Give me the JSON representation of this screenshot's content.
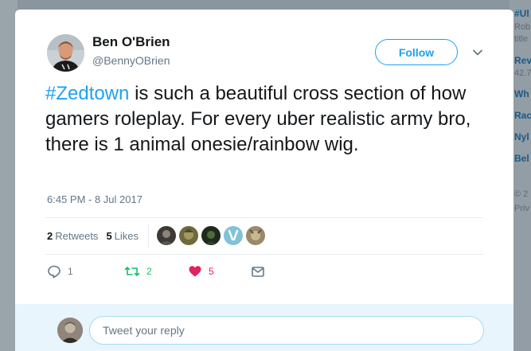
{
  "background": {
    "right_column": [
      {
        "text": "#Ul",
        "kind": "link"
      },
      {
        "text": "Rob",
        "kind": "text"
      },
      {
        "text": "title",
        "kind": "text"
      },
      {
        "text": "Rev",
        "kind": "link"
      },
      {
        "text": "42.7",
        "kind": "text"
      },
      {
        "text": "Wh",
        "kind": "link"
      },
      {
        "text": "Rac",
        "kind": "link"
      },
      {
        "text": "Nyl",
        "kind": "link"
      },
      {
        "text": "Bel",
        "kind": "link"
      },
      {
        "text": "© 2",
        "kind": "text"
      },
      {
        "text": "Priv",
        "kind": "text"
      }
    ]
  },
  "author": {
    "name": "Ben O'Brien",
    "handle": "@BennyOBrien",
    "avatar_icon": "user-avatar-photo"
  },
  "follow_label": "Follow",
  "tweet": {
    "hashtag": "#Zedtown",
    "text": " is such a beautiful cross section of how gamers roleplay. For every uber realistic army bro, there is 1 animal onesie/rainbow wig.",
    "timestamp": "6:45 PM - 8 Jul 2017"
  },
  "stats": {
    "retweets_count": "2",
    "retweets_label": "Retweets",
    "likes_count": "5",
    "likes_label": "Likes"
  },
  "likers": [
    {
      "icon": "liker-avatar-1",
      "color": "#3d3a36"
    },
    {
      "icon": "liker-avatar-2",
      "color": "#6f6a3c"
    },
    {
      "icon": "liker-avatar-3",
      "color": "#1f2a1c"
    },
    {
      "icon": "liker-avatar-4",
      "color": "#7fc3d8"
    },
    {
      "icon": "liker-avatar-5",
      "color": "#9a8a6a"
    }
  ],
  "actions": {
    "reply_count": "1",
    "retweet_count": "2",
    "like_count": "5"
  },
  "reply": {
    "placeholder": "Tweet your reply"
  },
  "colors": {
    "accent": "#1da1f2",
    "retweet": "#17bf63",
    "like": "#e0245e",
    "muted": "#657786"
  }
}
